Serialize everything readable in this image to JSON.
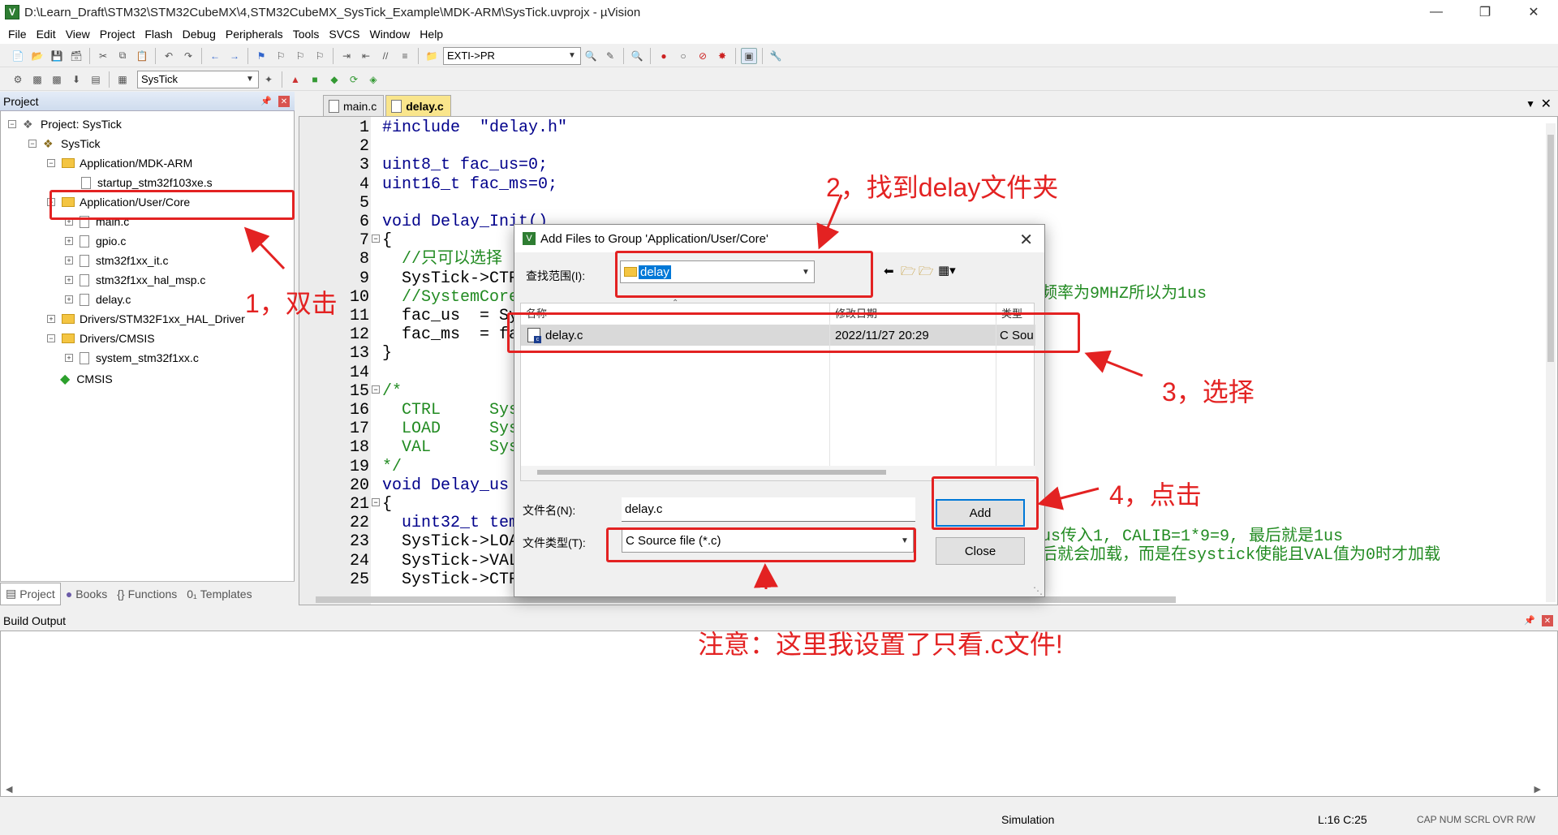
{
  "window": {
    "title": "D:\\Learn_Draft\\STM32\\STM32CubeMX\\4,STM32CubeMX_SysTick_Example\\MDK-ARM\\SysTick.uvprojx - µVision",
    "icon_text": "V"
  },
  "menu": [
    "File",
    "Edit",
    "View",
    "Project",
    "Flash",
    "Debug",
    "Peripherals",
    "Tools",
    "SVCS",
    "Window",
    "Help"
  ],
  "toolbar1": {
    "target_combo": "EXTI->PR"
  },
  "toolbar2": {
    "project_combo": "SysTick"
  },
  "project_panel": {
    "title": "Project",
    "tree": [
      {
        "label": "Project: SysTick",
        "level": 0,
        "type": "root"
      },
      {
        "label": "SysTick",
        "level": 1,
        "type": "target"
      },
      {
        "label": "Application/MDK-ARM",
        "level": 2,
        "type": "folder"
      },
      {
        "label": "startup_stm32f103xe.s",
        "level": 3,
        "type": "file"
      },
      {
        "label": "Application/User/Core",
        "level": 2,
        "type": "folder"
      },
      {
        "label": "main.c",
        "level": 3,
        "type": "file"
      },
      {
        "label": "gpio.c",
        "level": 3,
        "type": "file"
      },
      {
        "label": "stm32f1xx_it.c",
        "level": 3,
        "type": "file"
      },
      {
        "label": "stm32f1xx_hal_msp.c",
        "level": 3,
        "type": "file"
      },
      {
        "label": "delay.c",
        "level": 3,
        "type": "file"
      },
      {
        "label": "Drivers/STM32F1xx_HAL_Driver",
        "level": 2,
        "type": "folder"
      },
      {
        "label": "Drivers/CMSIS",
        "level": 2,
        "type": "folder"
      },
      {
        "label": "system_stm32f1xx.c",
        "level": 3,
        "type": "file"
      },
      {
        "label": "CMSIS",
        "level": 2,
        "type": "diamond"
      }
    ],
    "tabs": [
      "Project",
      "Books",
      "Functions",
      "Templates"
    ]
  },
  "editor": {
    "tabs": [
      "main.c",
      "delay.c"
    ],
    "active_tab": "delay.c",
    "lines": [
      {
        "n": "1",
        "t": "#include  \"delay.h\""
      },
      {
        "n": "2",
        "t": ""
      },
      {
        "n": "3",
        "t": "uint8_t fac_us=0;"
      },
      {
        "n": "4",
        "t": "uint16_t fac_ms=0;"
      },
      {
        "n": "5",
        "t": ""
      },
      {
        "n": "6",
        "t": "void Delay_Init()"
      },
      {
        "n": "7",
        "t": "{"
      },
      {
        "n": "8",
        "t": "  //只可以选择"
      },
      {
        "n": "9",
        "t": "  SysTick->CTR"
      },
      {
        "n": "10",
        "t": "  //SystemCore"
      },
      {
        "n": "11",
        "t": "  fac_us  = Sy"
      },
      {
        "n": "12",
        "t": "  fac_ms  = fa"
      },
      {
        "n": "13",
        "t": "}"
      },
      {
        "n": "14",
        "t": ""
      },
      {
        "n": "15",
        "t": "/*"
      },
      {
        "n": "16",
        "t": "  CTRL     Sys"
      },
      {
        "n": "17",
        "t": "  LOAD     Sys"
      },
      {
        "n": "18",
        "t": "  VAL      Sys"
      },
      {
        "n": "19",
        "t": "*/"
      },
      {
        "n": "20",
        "t": "void Delay_us"
      },
      {
        "n": "21",
        "t": "{"
      },
      {
        "n": "22",
        "t": "  uint32_t tem"
      },
      {
        "n": "23",
        "t": "  SysTick->LOA"
      },
      {
        "n": "24",
        "t": "  SysTick->VAL"
      },
      {
        "n": "25",
        "t": "  SysTick->CTR"
      }
    ],
    "right_comments": {
      "line10": "频率为9MHZ所以为1us",
      "line23": "us传入1, CALIB=1*9=9, 最后就是1us",
      "line24": "后就会加载，而是在systick使能且VAL值为0时才加载"
    }
  },
  "dialog": {
    "title": "Add Files to Group 'Application/User/Core'",
    "look_in_label": "查找范围(I):",
    "look_in_value": "delay",
    "columns": [
      "名称",
      "修改日期",
      "类型"
    ],
    "files": [
      {
        "name": "delay.c",
        "date": "2022/11/27 20:29",
        "type": "C Sou"
      }
    ],
    "filename_label": "文件名(N):",
    "filename_value": "delay.c",
    "filetype_label": "文件类型(T):",
    "filetype_value": "C Source file (*.c)",
    "add_label": "Add",
    "close_label": "Close"
  },
  "annotations": {
    "step1": "1，双击",
    "step2": "2，找到delay文件夹",
    "step3": "3，选择",
    "step4": "4，点击",
    "note": "注意：这里我设置了只看.c文件!"
  },
  "build_output": {
    "title": "Build Output"
  },
  "status": {
    "mode": "Simulation",
    "position": "L:16 C:25",
    "keys": "CAP NUM SCRL OVR R/W"
  },
  "colors": {
    "annotation": "#e32222",
    "active_tab": "#f9e58c",
    "comment": "#228b22"
  }
}
